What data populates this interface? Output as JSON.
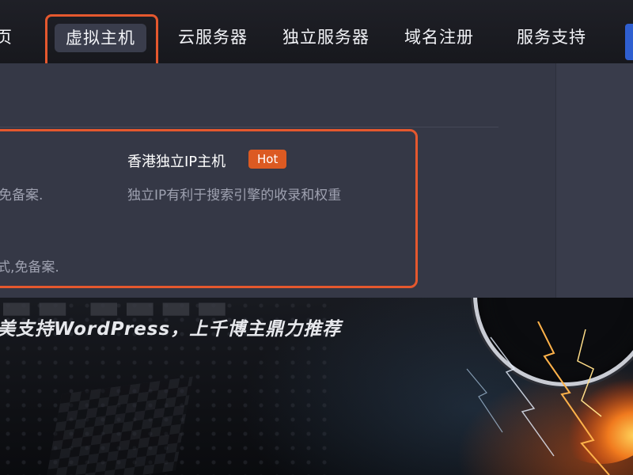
{
  "nav": {
    "items": [
      {
        "label": "页"
      },
      {
        "label": "虚拟主机"
      },
      {
        "label": "云服务器"
      },
      {
        "label": "独立服务器"
      },
      {
        "label": "域名注册"
      },
      {
        "label": "服务支持"
      }
    ]
  },
  "dropdown": {
    "left_desc_1": "免备案.",
    "left_desc_2": "式,免备案.",
    "product": {
      "title": "香港独立IP主机",
      "badge": "Hot",
      "description": "独立IP有利于搜索引擎的收录和权重"
    }
  },
  "banner": {
    "tagline": "美支持WordPress，上千博主鼎力推荐"
  },
  "colors": {
    "highlight": "#e5582e",
    "hot_badge": "#dc5a22",
    "nav_bg": "#1f2027",
    "dropdown_bg": "#353846"
  }
}
